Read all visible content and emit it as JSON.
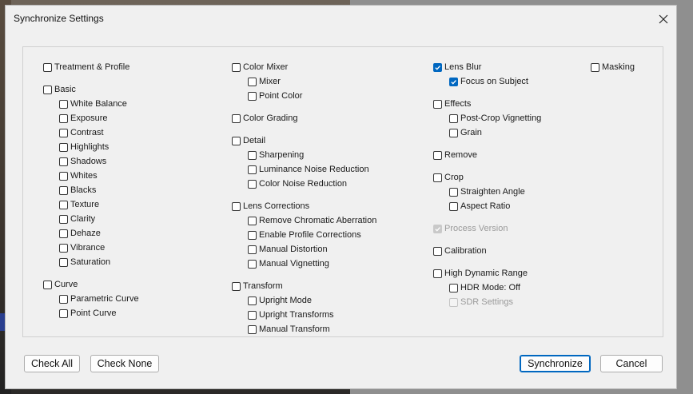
{
  "window": {
    "title": "Synchronize Settings"
  },
  "colors": {
    "accent": "#0067c0"
  },
  "icons": {
    "close": "close-icon",
    "check": "check-icon"
  },
  "columns": [
    [
      {
        "label": "Treatment & Profile",
        "checked": false,
        "level": 0,
        "gap": 0
      },
      {
        "label": "Basic",
        "checked": false,
        "level": 0,
        "gap": 1
      },
      {
        "label": "White Balance",
        "checked": false,
        "level": 1
      },
      {
        "label": "Exposure",
        "checked": false,
        "level": 1
      },
      {
        "label": "Contrast",
        "checked": false,
        "level": 1
      },
      {
        "label": "Highlights",
        "checked": false,
        "level": 1
      },
      {
        "label": "Shadows",
        "checked": false,
        "level": 1
      },
      {
        "label": "Whites",
        "checked": false,
        "level": 1
      },
      {
        "label": "Blacks",
        "checked": false,
        "level": 1
      },
      {
        "label": "Texture",
        "checked": false,
        "level": 1
      },
      {
        "label": "Clarity",
        "checked": false,
        "level": 1
      },
      {
        "label": "Dehaze",
        "checked": false,
        "level": 1
      },
      {
        "label": "Vibrance",
        "checked": false,
        "level": 1
      },
      {
        "label": "Saturation",
        "checked": false,
        "level": 1
      },
      {
        "label": "Curve",
        "checked": false,
        "level": 0,
        "gap": 1
      },
      {
        "label": "Parametric Curve",
        "checked": false,
        "level": 1
      },
      {
        "label": "Point Curve",
        "checked": false,
        "level": 1
      }
    ],
    [
      {
        "label": "Color Mixer",
        "checked": false,
        "level": 0,
        "gap": 0
      },
      {
        "label": "Mixer",
        "checked": false,
        "level": 1
      },
      {
        "label": "Point Color",
        "checked": false,
        "level": 1
      },
      {
        "label": "Color Grading",
        "checked": false,
        "level": 0,
        "gap": 1
      },
      {
        "label": "Detail",
        "checked": false,
        "level": 0,
        "gap": 1
      },
      {
        "label": "Sharpening",
        "checked": false,
        "level": 1
      },
      {
        "label": "Luminance Noise Reduction",
        "checked": false,
        "level": 1
      },
      {
        "label": "Color Noise Reduction",
        "checked": false,
        "level": 1
      },
      {
        "label": "Lens Corrections",
        "checked": false,
        "level": 0,
        "gap": 1
      },
      {
        "label": "Remove Chromatic Aberration",
        "checked": false,
        "level": 1
      },
      {
        "label": "Enable Profile Corrections",
        "checked": false,
        "level": 1
      },
      {
        "label": "Manual Distortion",
        "checked": false,
        "level": 1
      },
      {
        "label": "Manual Vignetting",
        "checked": false,
        "level": 1
      },
      {
        "label": "Transform",
        "checked": false,
        "level": 0,
        "gap": 1
      },
      {
        "label": "Upright Mode",
        "checked": false,
        "level": 1
      },
      {
        "label": "Upright Transforms",
        "checked": false,
        "level": 1
      },
      {
        "label": "Manual Transform",
        "checked": false,
        "level": 1
      }
    ],
    [
      {
        "label": "Lens Blur",
        "checked": true,
        "level": 0,
        "gap": 0
      },
      {
        "label": "Focus on Subject",
        "checked": true,
        "level": 1
      },
      {
        "label": "Effects",
        "checked": false,
        "level": 0,
        "gap": 1
      },
      {
        "label": "Post-Crop Vignetting",
        "checked": false,
        "level": 1
      },
      {
        "label": "Grain",
        "checked": false,
        "level": 1
      },
      {
        "label": "Remove",
        "checked": false,
        "level": 0,
        "gap": 1
      },
      {
        "label": "Crop",
        "checked": false,
        "level": 0,
        "gap": 1
      },
      {
        "label": "Straighten Angle",
        "checked": false,
        "level": 1
      },
      {
        "label": "Aspect Ratio",
        "checked": false,
        "level": 1
      },
      {
        "label": "Process Version",
        "checked": true,
        "level": 0,
        "gap": 1,
        "disabled": true
      },
      {
        "label": "Calibration",
        "checked": false,
        "level": 0,
        "gap": 1
      },
      {
        "label": "High Dynamic Range",
        "checked": false,
        "level": 0,
        "gap": 1
      },
      {
        "label": "HDR Mode: Off",
        "checked": false,
        "level": 1
      },
      {
        "label": "SDR Settings",
        "checked": false,
        "level": 1,
        "disabled": true
      }
    ],
    [
      {
        "label": "Masking",
        "checked": false,
        "level": 0,
        "gap": 0
      }
    ]
  ],
  "buttons": {
    "check_all": "Check All",
    "check_none": "Check None",
    "synchronize": "Synchronize",
    "cancel": "Cancel"
  }
}
